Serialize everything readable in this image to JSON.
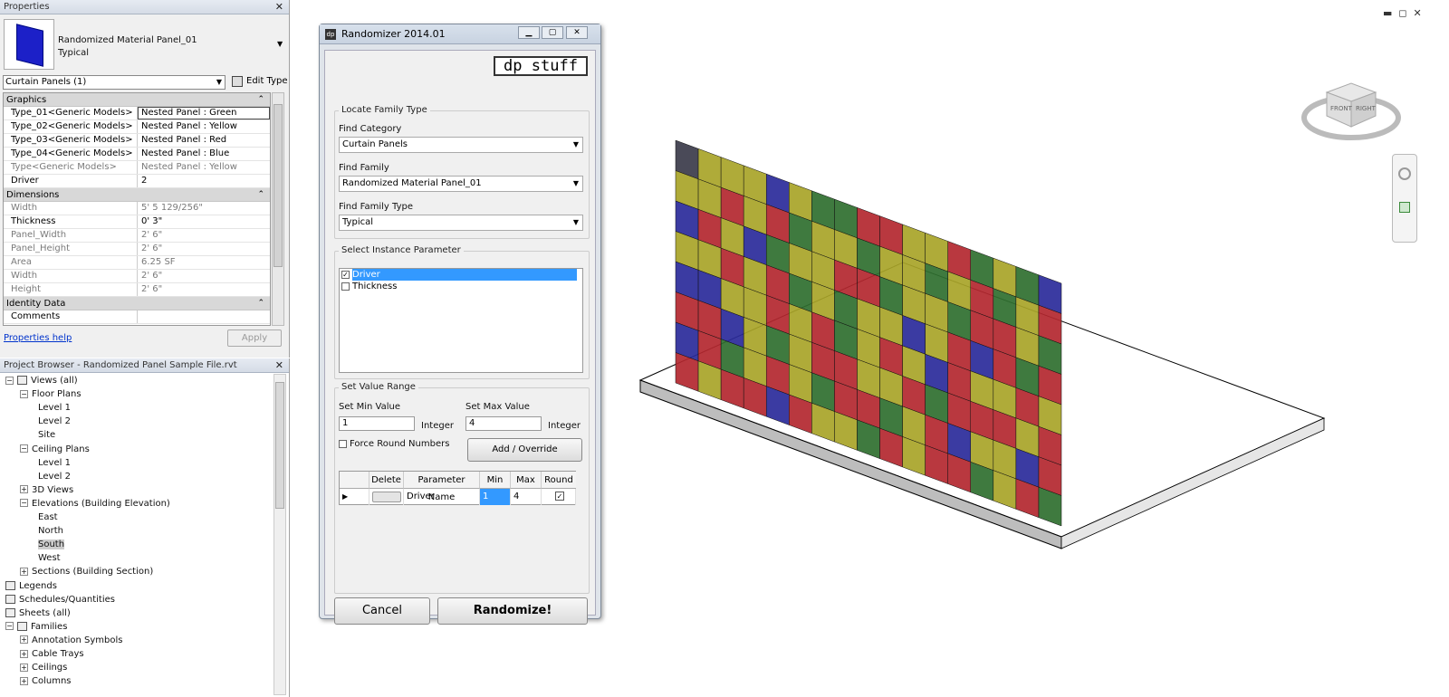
{
  "properties": {
    "title": "Properties",
    "type_name": "Randomized Material Panel_01",
    "type_sub": "Typical",
    "category_selector": "Curtain Panels (1)",
    "edit_type": "Edit Type",
    "groups": [
      {
        "name": "Graphics",
        "rows": [
          {
            "name": "Type_01<Generic Models>",
            "value": "Nested Panel : Green"
          },
          {
            "name": "Type_02<Generic Models>",
            "value": "Nested Panel : Yellow"
          },
          {
            "name": "Type_03<Generic Models>",
            "value": "Nested Panel : Red"
          },
          {
            "name": "Type_04<Generic Models>",
            "value": "Nested Panel : Blue"
          },
          {
            "name": "Type<Generic Models>",
            "value": "Nested Panel : Yellow"
          },
          {
            "name": "Driver",
            "value": "2"
          }
        ]
      },
      {
        "name": "Dimensions",
        "rows": [
          {
            "name": "Width",
            "value": "5'  5 129/256\""
          },
          {
            "name": "Thickness",
            "value": "0'  3\""
          },
          {
            "name": "Panel_Width",
            "value": "2'  6\""
          },
          {
            "name": "Panel_Height",
            "value": "2'  6\""
          },
          {
            "name": "Area",
            "value": "6.25 SF"
          },
          {
            "name": "Width",
            "value": "2'  6\""
          },
          {
            "name": "Height",
            "value": "2'  6\""
          }
        ]
      },
      {
        "name": "Identity Data",
        "rows": [
          {
            "name": "Comments",
            "value": ""
          }
        ]
      }
    ],
    "help_link": "Properties help",
    "apply": "Apply"
  },
  "browser": {
    "title": "Project Browser - Randomized Panel Sample File.rvt",
    "items": [
      "Views (all)",
      "Floor Plans",
      "Level 1",
      "Level 2",
      "Site",
      "Ceiling Plans",
      "Level 1",
      "Level 2",
      "3D Views",
      "Elevations (Building Elevation)",
      "East",
      "North",
      "South",
      "West",
      "Sections (Building Section)",
      "Legends",
      "Schedules/Quantities",
      "Sheets (all)",
      "Families",
      "Annotation Symbols",
      "Cable Trays",
      "Ceilings",
      "Columns"
    ]
  },
  "dialog": {
    "title": "Randomizer 2014.01",
    "logo_text": "dp stuff",
    "locate_group": "Locate Family Type",
    "find_category_label": "Find Category",
    "find_category_value": "Curtain Panels",
    "find_family_label": "Find Family",
    "find_family_value": "Randomized Material Panel_01",
    "find_type_label": "Find Family Type",
    "find_type_value": "Typical",
    "select_param_group": "Select Instance Parameter",
    "params": [
      {
        "label": "Driver",
        "checked": true,
        "selected": true
      },
      {
        "label": "Thickness",
        "checked": false,
        "selected": false
      }
    ],
    "range_group": "Set Value Range",
    "min_label": "Set Min Value",
    "min_value": "1",
    "min_unit": "Integer",
    "max_label": "Set Max Value",
    "max_value": "4",
    "max_unit": "Integer",
    "force_round": "Force Round Numbers",
    "add_override": "Add / Override",
    "table_headers": [
      "Delete",
      "Parameter Name",
      "Min",
      "Max",
      "Round"
    ],
    "table_row": {
      "param": "Driver",
      "min": "1",
      "max": "4"
    },
    "cancel": "Cancel",
    "randomize": "Randomize!"
  },
  "viewcube": {
    "front": "FRONT",
    "right": "RIGHT"
  },
  "colors": {
    "green": "#2f6f2f",
    "yellow": "#a8a428",
    "red": "#b3272f",
    "blue": "#2a2a9a"
  }
}
